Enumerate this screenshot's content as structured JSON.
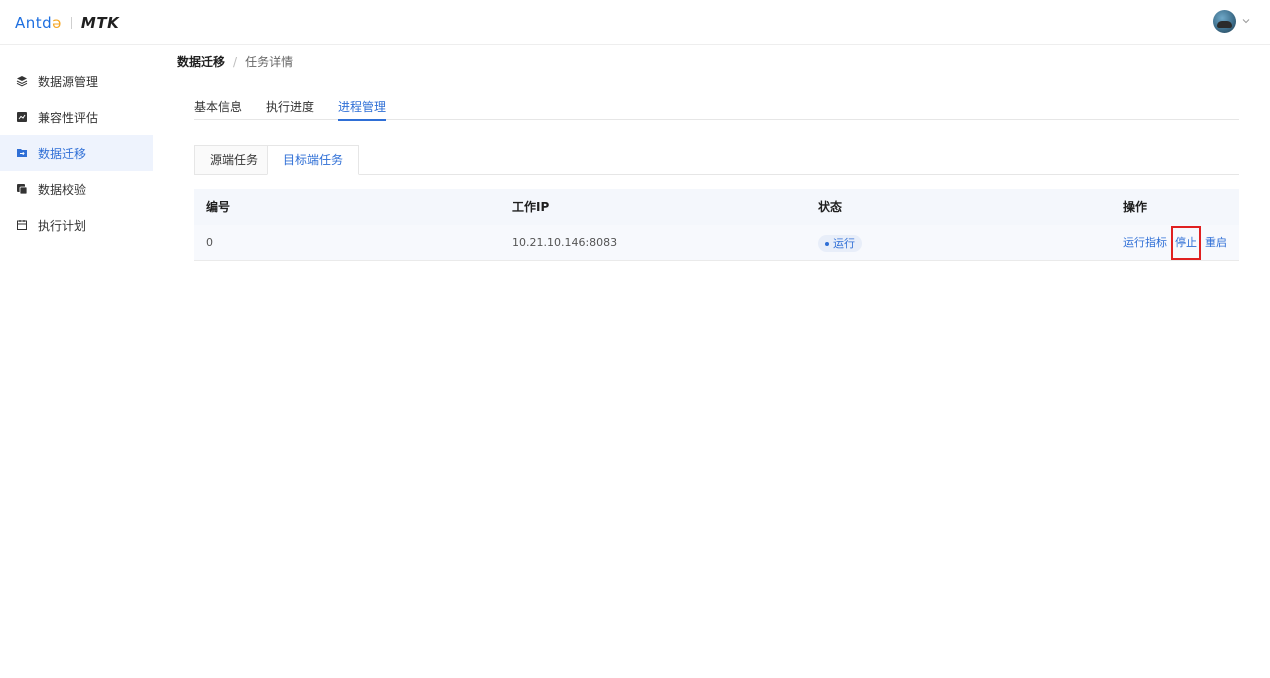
{
  "header": {
    "logo_antd": "Antd",
    "logo_mtk": "MTK",
    "avatar_icon": "user-avatar",
    "chevron_icon": "chevron-down-icon"
  },
  "sidebar": {
    "items": [
      {
        "label": "数据源管理",
        "icon": "layers-icon",
        "active": false
      },
      {
        "label": "兼容性评估",
        "icon": "assessment-icon",
        "active": false
      },
      {
        "label": "数据迁移",
        "icon": "folder-transfer-icon",
        "active": true
      },
      {
        "label": "数据校验",
        "icon": "verify-icon",
        "active": false
      },
      {
        "label": "执行计划",
        "icon": "calendar-icon",
        "active": false
      }
    ]
  },
  "breadcrumb": {
    "parent": "数据迁移",
    "separator": "/",
    "current": "任务详情"
  },
  "tabs": [
    {
      "label": "基本信息",
      "active": false
    },
    {
      "label": "执行进度",
      "active": false
    },
    {
      "label": "进程管理",
      "active": true
    }
  ],
  "sub_tabs": [
    {
      "label": "源端任务",
      "active": false
    },
    {
      "label": "目标端任务",
      "active": true
    }
  ],
  "table": {
    "columns": [
      "编号",
      "工作IP",
      "状态",
      "操作"
    ],
    "rows": [
      {
        "id": "0",
        "ip": "10.21.10.146:8083",
        "status": "运行",
        "actions": [
          "运行指标",
          "停止",
          "重启"
        ]
      }
    ]
  },
  "colors": {
    "accent": "#2f6fd6",
    "active_bg": "#eef3fd",
    "highlight": "#e02020"
  }
}
